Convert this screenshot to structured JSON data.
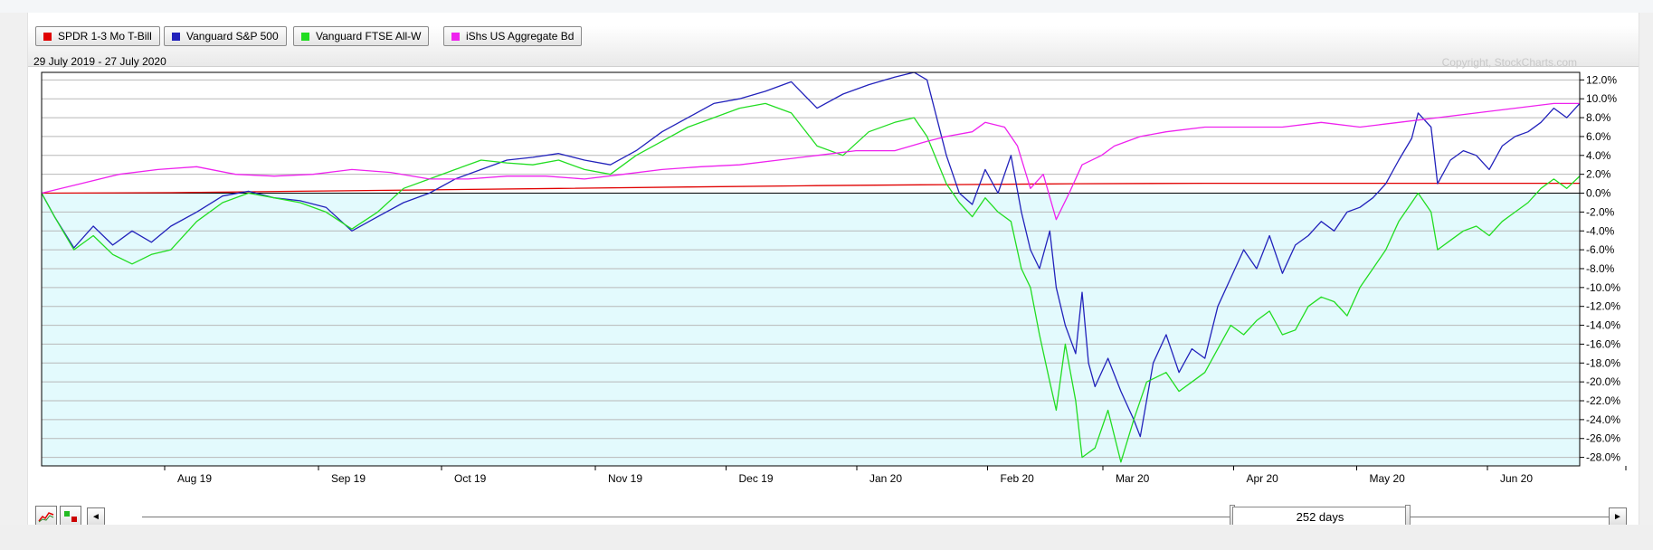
{
  "legend": [
    {
      "label": "SPDR 1-3 Mo T-Bill",
      "color": "#e00000"
    },
    {
      "label": "Vanguard S&P 500",
      "color": "#2222bb"
    },
    {
      "label": "Vanguard FTSE All-W",
      "color": "#22dd22"
    },
    {
      "label": "iShs US Aggregate Bd",
      "color": "#ee22ee"
    }
  ],
  "date_range": "29 July 2019 - 27 July 2020",
  "copyright": "Copyright, StockCharts.com",
  "controls": {
    "prev_glyph": "◄",
    "next_glyph": "►",
    "range_label": "252 days",
    "icons": [
      "line-chart-icon",
      "performance-bars-icon"
    ]
  },
  "chart_data": {
    "type": "line",
    "x_tick_labels": [
      "Aug 19",
      "Sep 19",
      "Oct 19",
      "Nov 19",
      "Dec 19",
      "Jan 20",
      "Feb 20",
      "Mar 20",
      "Apr 20",
      "May 20",
      "Jun 20",
      "Jul 20"
    ],
    "x_tick_positions": [
      0.08,
      0.18,
      0.26,
      0.36,
      0.445,
      0.53,
      0.615,
      0.69,
      0.775,
      0.855,
      0.94,
      1.03
    ],
    "y_tick_labels": [
      "12.0%",
      "10.0%",
      "8.0%",
      "6.0%",
      "4.0%",
      "2.0%",
      "0.0%",
      "-2.0%",
      "-4.0%",
      "-6.0%",
      "-8.0%",
      "-10.0%",
      "-12.0%",
      "-14.0%",
      "-16.0%",
      "-18.0%",
      "-20.0%",
      "-22.0%",
      "-24.0%",
      "-26.0%",
      "-28.0%"
    ],
    "ylim": [
      -28.9,
      12.8
    ],
    "x_range": [
      0,
      11.9
    ],
    "y_axis_side": "right",
    "zero_line": true,
    "grid": true,
    "series": [
      {
        "name": "SPDR 1-3 Mo T-Bill",
        "color": "#e00000",
        "points": [
          [
            0,
            0
          ],
          [
            1,
            0.05
          ],
          [
            2,
            0.2
          ],
          [
            3,
            0.35
          ],
          [
            4,
            0.5
          ],
          [
            5,
            0.65
          ],
          [
            6,
            0.8
          ],
          [
            7,
            0.9
          ],
          [
            8,
            1.0
          ],
          [
            9,
            1.05
          ],
          [
            10,
            1.05
          ],
          [
            11.9,
            1.05
          ]
        ]
      },
      {
        "name": "Vanguard S&P 500",
        "color": "#2222bb",
        "points": [
          [
            0,
            0
          ],
          [
            0.1,
            -2.5
          ],
          [
            0.25,
            -5.8
          ],
          [
            0.4,
            -3.5
          ],
          [
            0.55,
            -5.5
          ],
          [
            0.7,
            -4
          ],
          [
            0.85,
            -5.2
          ],
          [
            1,
            -3.5
          ],
          [
            1.2,
            -2
          ],
          [
            1.4,
            -0.3
          ],
          [
            1.6,
            0.2
          ],
          [
            1.8,
            -0.5
          ],
          [
            2,
            -0.8
          ],
          [
            2.2,
            -1.5
          ],
          [
            2.4,
            -4
          ],
          [
            2.6,
            -2.5
          ],
          [
            2.8,
            -1
          ],
          [
            3,
            0
          ],
          [
            3.2,
            1.5
          ],
          [
            3.4,
            2.5
          ],
          [
            3.6,
            3.5
          ],
          [
            3.8,
            3.8
          ],
          [
            4,
            4.2
          ],
          [
            4.2,
            3.5
          ],
          [
            4.4,
            3
          ],
          [
            4.6,
            4.5
          ],
          [
            4.8,
            6.5
          ],
          [
            5,
            8
          ],
          [
            5.2,
            9.5
          ],
          [
            5.4,
            10
          ],
          [
            5.6,
            10.8
          ],
          [
            5.8,
            11.8
          ],
          [
            6,
            9
          ],
          [
            6.2,
            10.5
          ],
          [
            6.4,
            11.5
          ],
          [
            6.6,
            12.3
          ],
          [
            6.75,
            12.8
          ],
          [
            6.85,
            12
          ],
          [
            7,
            4
          ],
          [
            7.1,
            0
          ],
          [
            7.2,
            -1.2
          ],
          [
            7.3,
            2.5
          ],
          [
            7.4,
            0
          ],
          [
            7.5,
            4
          ],
          [
            7.58,
            -2
          ],
          [
            7.65,
            -6
          ],
          [
            7.72,
            -8
          ],
          [
            7.8,
            -4
          ],
          [
            7.85,
            -10
          ],
          [
            7.92,
            -14
          ],
          [
            8,
            -17
          ],
          [
            8.05,
            -10.5
          ],
          [
            8.1,
            -18
          ],
          [
            8.15,
            -20.5
          ],
          [
            8.25,
            -17.5
          ],
          [
            8.35,
            -21
          ],
          [
            8.45,
            -24
          ],
          [
            8.5,
            -25.8
          ],
          [
            8.6,
            -18
          ],
          [
            8.7,
            -15
          ],
          [
            8.8,
            -19
          ],
          [
            8.9,
            -16.5
          ],
          [
            9,
            -17.5
          ],
          [
            9.1,
            -12
          ],
          [
            9.2,
            -9
          ],
          [
            9.3,
            -6
          ],
          [
            9.4,
            -8
          ],
          [
            9.5,
            -4.5
          ],
          [
            9.6,
            -8.5
          ],
          [
            9.7,
            -5.5
          ],
          [
            9.8,
            -4.5
          ],
          [
            9.9,
            -3
          ],
          [
            10,
            -4
          ],
          [
            10.1,
            -2
          ],
          [
            10.2,
            -1.5
          ],
          [
            10.3,
            -0.5
          ],
          [
            10.4,
            1
          ],
          [
            10.5,
            3.5
          ],
          [
            10.6,
            5.8
          ],
          [
            10.65,
            8.5
          ],
          [
            10.75,
            7
          ],
          [
            10.8,
            1
          ],
          [
            10.9,
            3.5
          ],
          [
            11,
            4.5
          ],
          [
            11.1,
            4
          ],
          [
            11.2,
            2.5
          ],
          [
            11.3,
            5
          ],
          [
            11.4,
            6
          ],
          [
            11.5,
            6.5
          ],
          [
            11.6,
            7.5
          ],
          [
            11.7,
            9
          ],
          [
            11.8,
            8
          ],
          [
            11.9,
            9.5
          ]
        ]
      },
      {
        "name": "Vanguard FTSE All-W",
        "color": "#22dd22",
        "points": [
          [
            0,
            0
          ],
          [
            0.1,
            -2.5
          ],
          [
            0.25,
            -6
          ],
          [
            0.4,
            -4.5
          ],
          [
            0.55,
            -6.5
          ],
          [
            0.7,
            -7.5
          ],
          [
            0.85,
            -6.5
          ],
          [
            1,
            -6
          ],
          [
            1.2,
            -3
          ],
          [
            1.4,
            -1
          ],
          [
            1.6,
            0
          ],
          [
            1.8,
            -0.5
          ],
          [
            2,
            -1
          ],
          [
            2.2,
            -2
          ],
          [
            2.4,
            -3.8
          ],
          [
            2.6,
            -2
          ],
          [
            2.8,
            0.5
          ],
          [
            3,
            1.5
          ],
          [
            3.2,
            2.5
          ],
          [
            3.4,
            3.5
          ],
          [
            3.6,
            3.2
          ],
          [
            3.8,
            3
          ],
          [
            4,
            3.5
          ],
          [
            4.2,
            2.5
          ],
          [
            4.4,
            2
          ],
          [
            4.6,
            4
          ],
          [
            4.8,
            5.5
          ],
          [
            5,
            7
          ],
          [
            5.2,
            8
          ],
          [
            5.4,
            9
          ],
          [
            5.6,
            9.5
          ],
          [
            5.8,
            8.5
          ],
          [
            6,
            5
          ],
          [
            6.2,
            4
          ],
          [
            6.4,
            6.5
          ],
          [
            6.6,
            7.5
          ],
          [
            6.75,
            8
          ],
          [
            6.85,
            6
          ],
          [
            7,
            1
          ],
          [
            7.1,
            -1
          ],
          [
            7.2,
            -2.5
          ],
          [
            7.3,
            -0.5
          ],
          [
            7.4,
            -2
          ],
          [
            7.5,
            -3
          ],
          [
            7.58,
            -8
          ],
          [
            7.65,
            -10
          ],
          [
            7.72,
            -15
          ],
          [
            7.8,
            -20
          ],
          [
            7.85,
            -23
          ],
          [
            7.92,
            -16
          ],
          [
            8,
            -22
          ],
          [
            8.05,
            -28
          ],
          [
            8.15,
            -27
          ],
          [
            8.25,
            -23
          ],
          [
            8.35,
            -28.5
          ],
          [
            8.45,
            -24
          ],
          [
            8.55,
            -20
          ],
          [
            8.7,
            -19
          ],
          [
            8.8,
            -21
          ],
          [
            8.9,
            -20
          ],
          [
            9,
            -19
          ],
          [
            9.1,
            -16.5
          ],
          [
            9.2,
            -14
          ],
          [
            9.3,
            -15
          ],
          [
            9.4,
            -13.5
          ],
          [
            9.5,
            -12.5
          ],
          [
            9.6,
            -15
          ],
          [
            9.7,
            -14.5
          ],
          [
            9.8,
            -12
          ],
          [
            9.9,
            -11
          ],
          [
            10,
            -11.5
          ],
          [
            10.1,
            -13
          ],
          [
            10.2,
            -10
          ],
          [
            10.3,
            -8
          ],
          [
            10.4,
            -6
          ],
          [
            10.5,
            -3
          ],
          [
            10.6,
            -1
          ],
          [
            10.65,
            0
          ],
          [
            10.75,
            -2
          ],
          [
            10.8,
            -6
          ],
          [
            10.9,
            -5
          ],
          [
            11,
            -4
          ],
          [
            11.1,
            -3.5
          ],
          [
            11.2,
            -4.5
          ],
          [
            11.3,
            -3
          ],
          [
            11.4,
            -2
          ],
          [
            11.5,
            -1
          ],
          [
            11.6,
            0.5
          ],
          [
            11.7,
            1.5
          ],
          [
            11.8,
            0.5
          ],
          [
            11.9,
            1.8
          ]
        ]
      },
      {
        "name": "iShs US Aggregate Bd",
        "color": "#ee22ee",
        "points": [
          [
            0,
            0
          ],
          [
            0.3,
            1
          ],
          [
            0.6,
            2
          ],
          [
            0.9,
            2.5
          ],
          [
            1.2,
            2.8
          ],
          [
            1.5,
            2
          ],
          [
            1.8,
            1.8
          ],
          [
            2.1,
            2
          ],
          [
            2.4,
            2.5
          ],
          [
            2.7,
            2.2
          ],
          [
            3,
            1.5
          ],
          [
            3.3,
            1.5
          ],
          [
            3.6,
            1.8
          ],
          [
            3.9,
            1.8
          ],
          [
            4.2,
            1.5
          ],
          [
            4.5,
            2
          ],
          [
            4.8,
            2.5
          ],
          [
            5.1,
            2.8
          ],
          [
            5.4,
            3
          ],
          [
            5.7,
            3.5
          ],
          [
            6,
            4
          ],
          [
            6.3,
            4.5
          ],
          [
            6.6,
            4.5
          ],
          [
            6.85,
            5.5
          ],
          [
            7,
            6
          ],
          [
            7.2,
            6.5
          ],
          [
            7.3,
            7.5
          ],
          [
            7.45,
            7
          ],
          [
            7.55,
            5
          ],
          [
            7.65,
            0.5
          ],
          [
            7.75,
            2
          ],
          [
            7.85,
            -2.8
          ],
          [
            7.95,
            0
          ],
          [
            8.05,
            3
          ],
          [
            8.2,
            4
          ],
          [
            8.3,
            5
          ],
          [
            8.5,
            6
          ],
          [
            8.7,
            6.5
          ],
          [
            9,
            7
          ],
          [
            9.3,
            7
          ],
          [
            9.6,
            7
          ],
          [
            9.9,
            7.5
          ],
          [
            10.2,
            7
          ],
          [
            10.5,
            7.5
          ],
          [
            10.8,
            8
          ],
          [
            11.1,
            8.5
          ],
          [
            11.4,
            9
          ],
          [
            11.7,
            9.5
          ],
          [
            11.9,
            9.5
          ]
        ]
      }
    ]
  }
}
